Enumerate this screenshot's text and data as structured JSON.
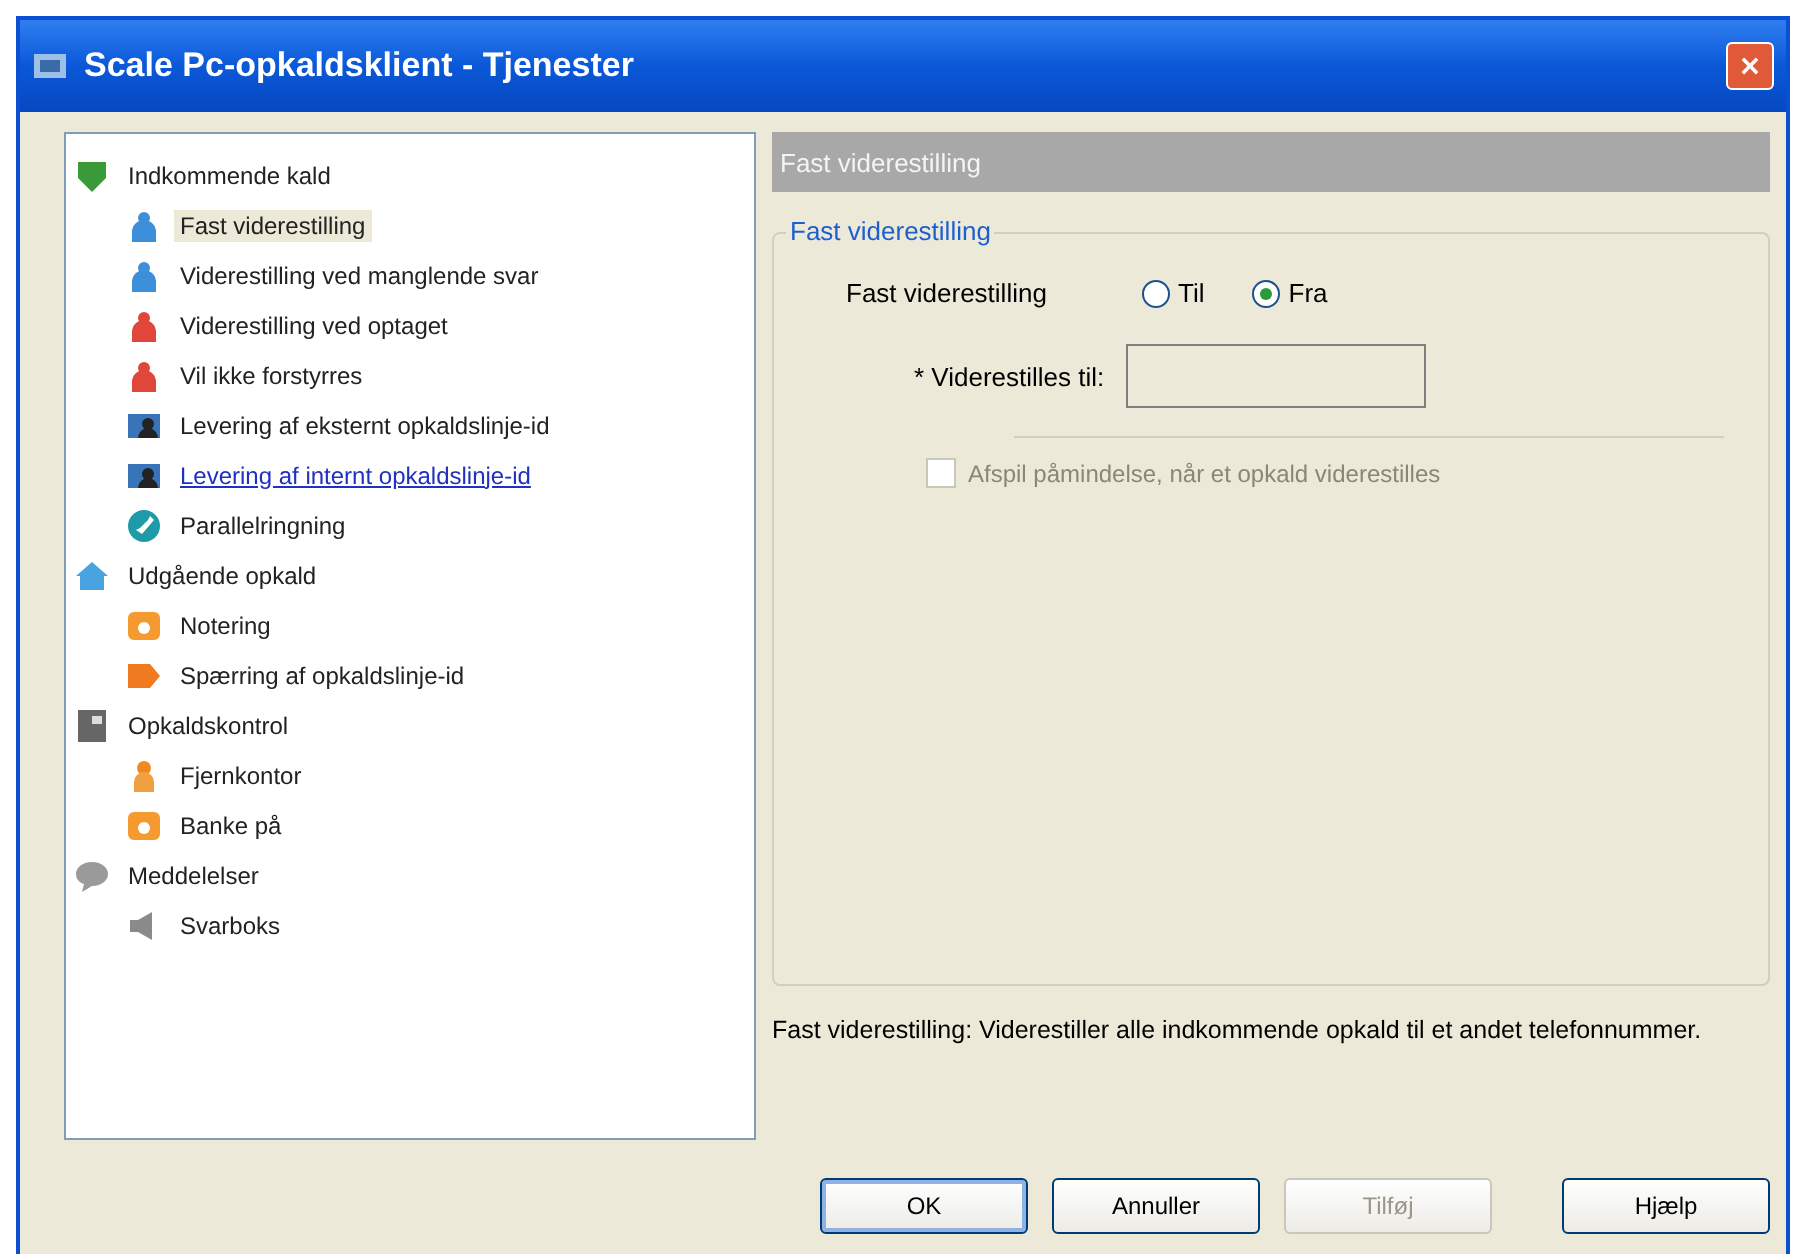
{
  "window": {
    "title": "Scale Pc-opkaldsklient - Tjenester"
  },
  "tree": [
    {
      "label": "Indkommende kald",
      "kind": "shield",
      "selected": false,
      "hovered": false,
      "children": [
        {
          "label": "Fast viderestilling",
          "kind": "person-blue",
          "selected": true,
          "hovered": false
        },
        {
          "label": "Viderestilling ved manglende svar",
          "kind": "person-blue",
          "selected": false,
          "hovered": false
        },
        {
          "label": "Viderestilling ved optaget",
          "kind": "person-red",
          "selected": false,
          "hovered": false
        },
        {
          "label": "Vil ikke forstyrres",
          "kind": "person-red",
          "selected": false,
          "hovered": false
        },
        {
          "label": "Levering af eksternt opkaldslinje-id",
          "kind": "card",
          "selected": false,
          "hovered": false
        },
        {
          "label": "Levering af internt opkaldslinje-id",
          "kind": "card",
          "selected": false,
          "hovered": true
        },
        {
          "label": "Parallelringning",
          "kind": "phone-circle",
          "selected": false,
          "hovered": false
        }
      ]
    },
    {
      "label": "Udgående opkald",
      "kind": "house",
      "selected": false,
      "hovered": false,
      "children": [
        {
          "label": "Notering",
          "kind": "phone-orange",
          "selected": false,
          "hovered": false
        },
        {
          "label": "Spærring af opkaldslinje-id",
          "kind": "tag",
          "selected": false,
          "hovered": false
        }
      ]
    },
    {
      "label": "Opkaldskontrol",
      "kind": "book",
      "selected": false,
      "hovered": false,
      "children": [
        {
          "label": "Fjernkontor",
          "kind": "person-orange",
          "selected": false,
          "hovered": false
        },
        {
          "label": "Banke på",
          "kind": "phone-orange",
          "selected": false,
          "hovered": false
        }
      ]
    },
    {
      "label": "Meddelelser",
      "kind": "bubble",
      "selected": false,
      "hovered": false,
      "children": [
        {
          "label": "Svarboks",
          "kind": "speaker",
          "selected": false,
          "hovered": false
        }
      ]
    }
  ],
  "panel": {
    "header": "Fast viderestilling",
    "group_title": "Fast viderestilling",
    "radio_label": "Fast viderestilling",
    "radios": [
      {
        "label": "Til",
        "selected": false
      },
      {
        "label": "Fra",
        "selected": true
      }
    ],
    "field_label": "* Viderestilles til:",
    "field_disabled": true,
    "checkbox": {
      "label": "Afspil påmindelse, når et opkald viderestilles",
      "checked": false,
      "disabled": true
    },
    "description": "Fast viderestilling: Viderestiller alle indkommende opkald til et andet telefonnummer."
  },
  "buttons": [
    {
      "label": "OK",
      "disabled": false,
      "default": true
    },
    {
      "label": "Annuller",
      "disabled": false,
      "default": false
    },
    {
      "label": "Tilføj",
      "disabled": true,
      "default": false
    },
    {
      "label": "Hjælp",
      "disabled": false,
      "default": false
    }
  ]
}
